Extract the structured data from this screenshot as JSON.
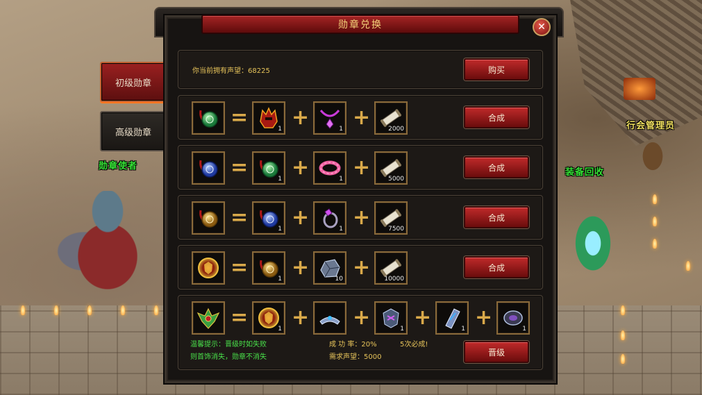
{
  "world": {
    "npc_medal": "勋章使者",
    "npc_guild": "行会管理员",
    "npc_recycle": "装备回收"
  },
  "tabs": [
    {
      "label": "初级勋章",
      "active": true
    },
    {
      "label": "高级勋章",
      "active": false
    }
  ],
  "panel": {
    "title": "勋章兑换",
    "close_symbol": "✕",
    "reputation_label": "你当前拥有声望：",
    "reputation_value": "68225",
    "buy_label": "购买"
  },
  "recipes": [
    {
      "result_icon": "green-jade-medal-icon",
      "op_eq": "=",
      "ingredients": [
        {
          "icon": "red-helmet-icon",
          "qty": "1"
        },
        {
          "icon": "purple-necklace-icon",
          "qty": "1"
        },
        {
          "icon": "reputation-scroll-icon",
          "qty": "2000"
        }
      ],
      "button": "合成"
    },
    {
      "result_icon": "blue-jade-medal-icon",
      "op_eq": "=",
      "ingredients": [
        {
          "icon": "green-jade-medal-icon",
          "qty": "1"
        },
        {
          "icon": "pink-bracelet-icon",
          "qty": "1"
        },
        {
          "icon": "reputation-scroll-icon",
          "qty": "5000"
        }
      ],
      "button": "合成"
    },
    {
      "result_icon": "gold-medal-icon",
      "op_eq": "=",
      "ingredients": [
        {
          "icon": "blue-jade-medal-icon",
          "qty": "1"
        },
        {
          "icon": "purple-ring-icon",
          "qty": "1"
        },
        {
          "icon": "reputation-scroll-icon",
          "qty": "7500"
        }
      ],
      "button": "合成"
    },
    {
      "result_icon": "lion-medal-icon",
      "op_eq": "=",
      "ingredients": [
        {
          "icon": "gold-medal-icon",
          "qty": "1"
        },
        {
          "icon": "iron-ore-icon",
          "qty": "10"
        },
        {
          "icon": "reputation-scroll-icon",
          "qty": "10000"
        }
      ],
      "button": "合成"
    }
  ],
  "upgrade": {
    "result_icon": "winged-emblem-icon",
    "op_eq": "=",
    "ingredients": [
      {
        "icon": "lion-medal-icon",
        "qty": "1"
      },
      {
        "icon": "silver-crown-icon",
        "qty": ""
      },
      {
        "icon": "armor-piece-icon",
        "qty": "1"
      },
      {
        "icon": "bracer-icon",
        "qty": "1"
      },
      {
        "icon": "dark-gem-icon",
        "qty": "1"
      }
    ],
    "tip_line1": "温馨提示：晋级时如失败",
    "tip_line2": "则首饰消失，勋章不消失",
    "success_rate": "成 功 率：20%",
    "guarantee": "5次必成!",
    "required_rep": "需求声望：5000",
    "button": "晋级"
  },
  "op_plus": "+",
  "colors": {
    "title_gold": "#f4d27a",
    "button_red": "#c02a2a",
    "slot_border": "#8a6a3a",
    "tip_green": "#49e04a",
    "tip_yellow": "#e6c35a"
  }
}
